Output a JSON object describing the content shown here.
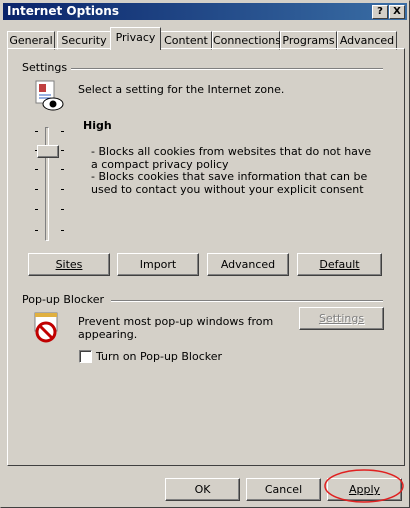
{
  "window": {
    "title": "Internet Options",
    "help_glyph": "?",
    "close_glyph": "X"
  },
  "tabs": [
    {
      "label": "General"
    },
    {
      "label": "Security"
    },
    {
      "label": "Privacy"
    },
    {
      "label": "Content"
    },
    {
      "label": "Connections"
    },
    {
      "label": "Programs"
    },
    {
      "label": "Advanced"
    }
  ],
  "settings": {
    "group_label": "Settings",
    "intro": "Select a setting for the Internet zone.",
    "level": "High",
    "desc1": "- Blocks all cookies from websites that do not have a compact privacy policy",
    "desc2": "- Blocks cookies that save information that can be used to contact you without your explicit consent",
    "buttons": {
      "sites": "Sites",
      "import": "Import",
      "advanced": "Advanced",
      "default": "Default"
    }
  },
  "popup": {
    "group_label": "Pop-up Blocker",
    "desc": "Prevent most pop-up windows from appearing.",
    "settings_button": "Settings",
    "checkbox_label": "Turn on Pop-up Blocker"
  },
  "footer": {
    "ok": "OK",
    "cancel": "Cancel",
    "apply": "Apply"
  }
}
